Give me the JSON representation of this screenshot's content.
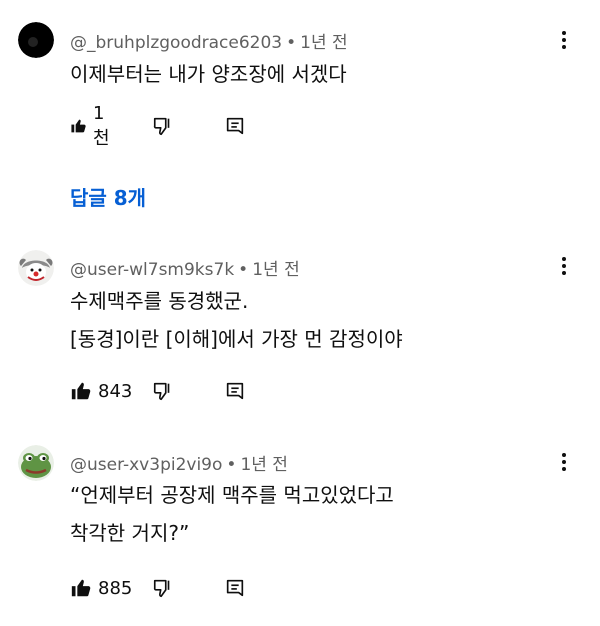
{
  "comments": [
    {
      "author": "@_bruhplzgoodrace6203",
      "separator": "•",
      "time": "1년 전",
      "lines": [
        "이제부터는 내가 양조장에 서겠다"
      ],
      "likes": "1천",
      "avatar_icon": "avatar-black"
    },
    {
      "author": "@user-wl7sm9ks7k",
      "separator": "•",
      "time": "1년 전",
      "lines": [
        "수제맥주를 동경했군.",
        "[동경]이란 [이해]에서 가장 먼 감정이야"
      ],
      "likes": "843",
      "avatar_icon": "avatar-clown"
    },
    {
      "author": "@user-xv3pi2vi9o",
      "separator": "•",
      "time": "1년 전",
      "lines": [
        "“언제부터 공장제 맥주를 먹고있었다고",
        "착각한 거지?”"
      ],
      "likes": "885",
      "avatar_icon": "avatar-frog"
    }
  ],
  "replies_link": "답글 8개",
  "colors": {
    "link": "#065fd4",
    "meta": "#606060",
    "text": "#0f0f0f"
  }
}
